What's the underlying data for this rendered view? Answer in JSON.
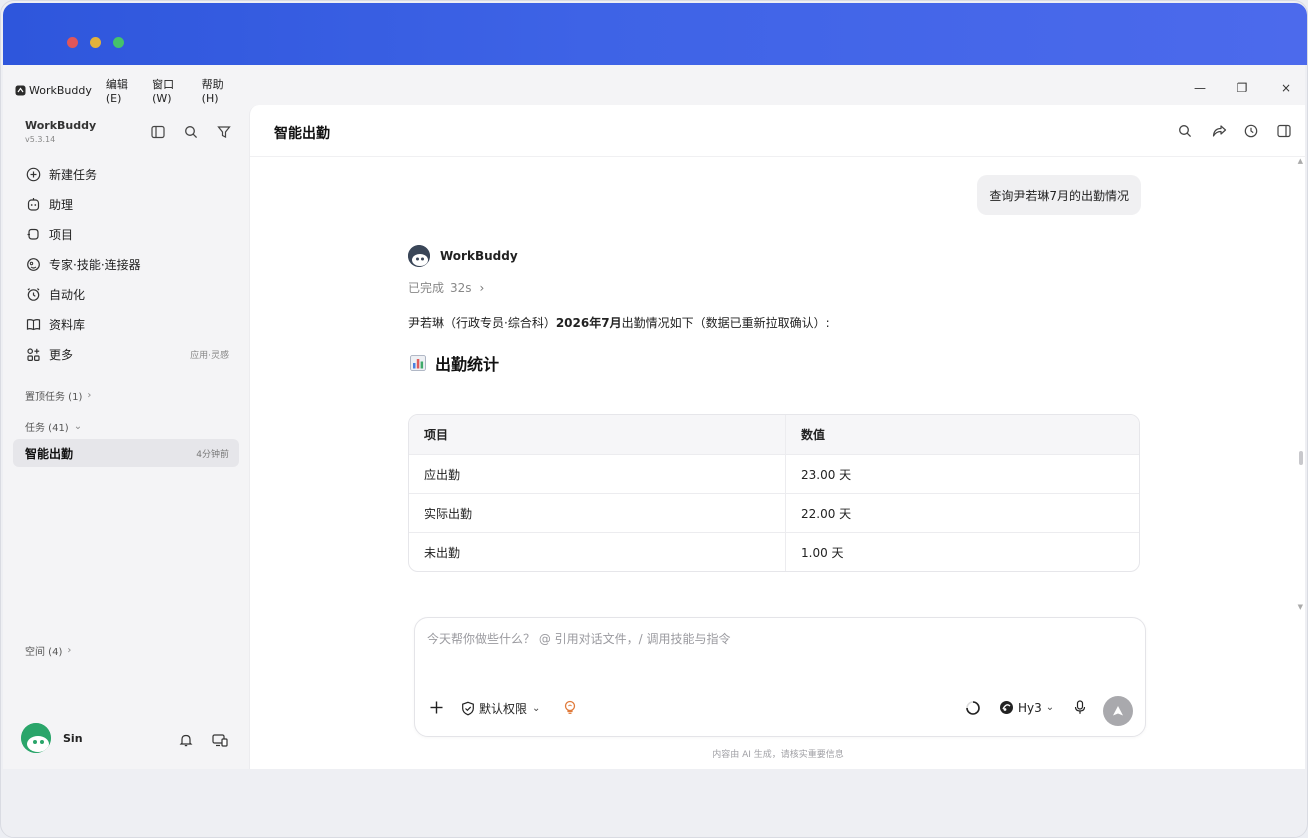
{
  "menubar": {
    "app_name": "WorkBuddy",
    "items": [
      "编辑(E)",
      "窗口(W)",
      "帮助(H)"
    ]
  },
  "window_controls": {
    "minimize": "—",
    "maximize": "❐",
    "close": "×"
  },
  "sidebar": {
    "brand": "WorkBuddy",
    "version": "v5.3.14",
    "nav": [
      {
        "label": "新建任务",
        "icon": "plus-circle-icon"
      },
      {
        "label": "助理",
        "icon": "robot-icon"
      },
      {
        "label": "项目",
        "icon": "project-icon"
      },
      {
        "label": "专家·技能·连接器",
        "icon": "expert-icon"
      },
      {
        "label": "自动化",
        "icon": "alarm-clock-icon"
      },
      {
        "label": "资料库",
        "icon": "book-icon"
      },
      {
        "label": "更多",
        "icon": "apps-icon",
        "extra": "应用·灵感"
      }
    ],
    "pinned_label": "置顶任务 (1)",
    "tasks_label": "任务 (41)",
    "active_task": {
      "title": "智能出勤",
      "time": "4分钟前"
    },
    "spaces_label": "空间 (4)",
    "user_name": "Sin"
  },
  "main": {
    "title": "智能出勤",
    "user_message": "查询尹若琳7月的出勤情况",
    "bot_name": "WorkBuddy",
    "status": "已完成",
    "duration": "32s",
    "answer_prefix": "尹若琳（行政专员·综合科）",
    "answer_bold": "2026年7月",
    "answer_suffix": "出勤情况如下（数据已重新拉取确认）:",
    "section_heading": "出勤统计",
    "table": {
      "headers": [
        "项目",
        "数值"
      ],
      "rows": [
        [
          "应出勤",
          "23.00 天"
        ],
        [
          "实际出勤",
          "22.00 天"
        ],
        [
          "未出勤",
          "1.00 天"
        ]
      ]
    },
    "composer": {
      "placeholder": "今天帮你做些什么？ @ 引用对话文件，/ 调用技能与指令",
      "permission_label": "默认权限",
      "model_label": "Hy3"
    },
    "disclaimer": "内容由 AI 生成，请核实重要信息"
  },
  "colors": {
    "title_gradient_start": "#2e56dc",
    "title_gradient_end": "#4c6aec",
    "active_task_bg": "#e6e6ea",
    "send_button": "#a9a9ad"
  }
}
